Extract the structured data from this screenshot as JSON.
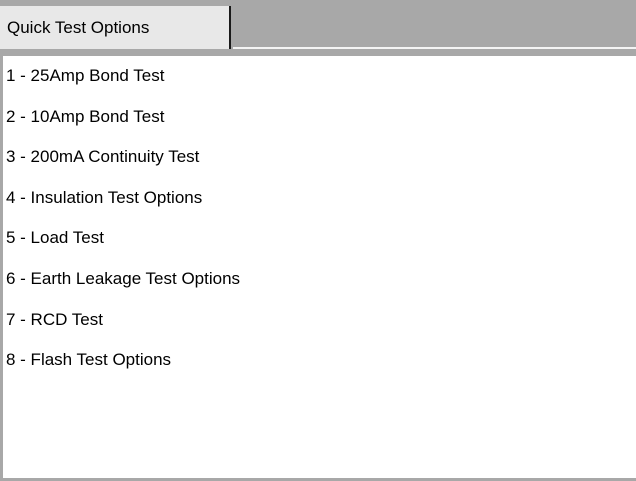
{
  "tabs": [
    {
      "label": "Quick Test Options",
      "selected": true
    }
  ],
  "options": [
    {
      "label": "1 - 25Amp Bond Test"
    },
    {
      "label": "2 - 10Amp Bond Test"
    },
    {
      "label": "3 - 200mA Continuity Test"
    },
    {
      "label": "4 - Insulation Test Options"
    },
    {
      "label": "5 - Load Test"
    },
    {
      "label": "6 - Earth Leakage Test Options"
    },
    {
      "label": "7 - RCD Test"
    },
    {
      "label": "8 - Flash Test Options"
    }
  ],
  "colors": {
    "tab_bar": "#a8a8a8",
    "selected_tab": "#e8e8e8",
    "panel_background": "#ffffff"
  }
}
